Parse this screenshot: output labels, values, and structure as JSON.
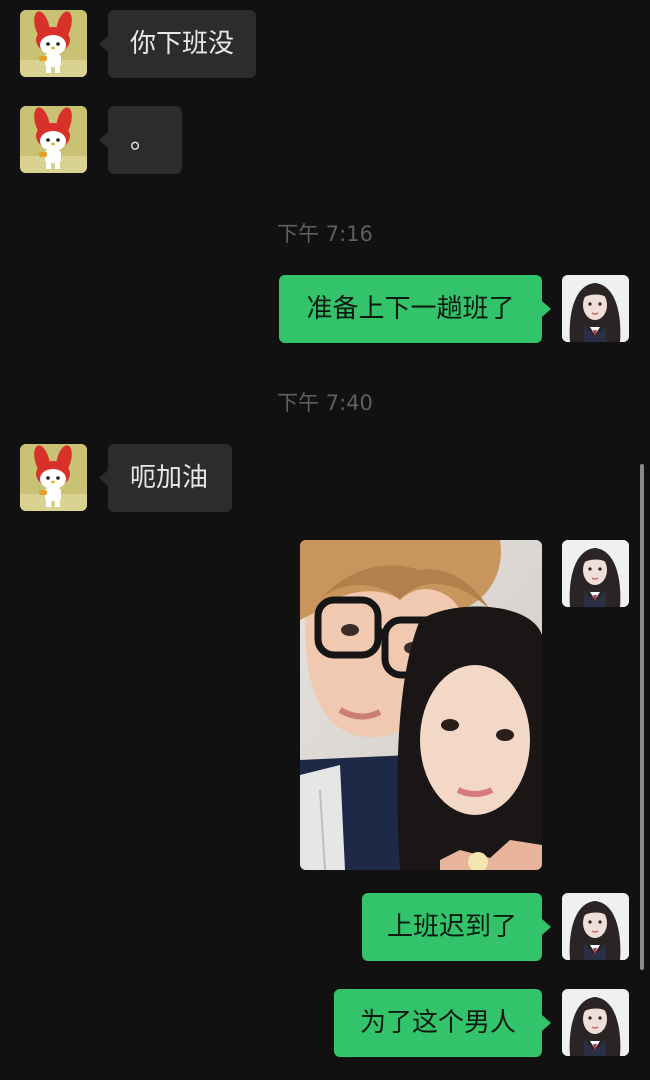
{
  "messages": {
    "m1": {
      "text": "你下班没",
      "direction": "incoming"
    },
    "m2": {
      "text": "。",
      "direction": "incoming"
    },
    "t1": "下午 7:16",
    "m3": {
      "text": "准备上下一趟班了",
      "direction": "outgoing"
    },
    "t2": "下午 7:40",
    "m4": {
      "text": "呃加油",
      "direction": "incoming"
    },
    "m5": {
      "type": "photo",
      "direction": "outgoing"
    },
    "m6": {
      "text": "上班迟到了",
      "direction": "outgoing"
    },
    "m7": {
      "text": "为了这个男人",
      "direction": "outgoing"
    }
  },
  "icons": {
    "contact_avatar": "melody-avatar-icon",
    "self_avatar": "girl-avatar-icon"
  },
  "colors": {
    "background": "#111111",
    "incoming_bubble": "#2c2c2c",
    "outgoing_bubble": "#32c36b",
    "timestamp": "#5f5f5f"
  }
}
